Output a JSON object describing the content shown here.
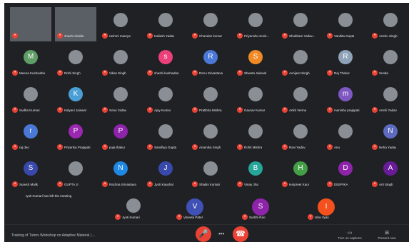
{
  "colors": {
    "background": "#202124",
    "mic_muted": "#ea4335",
    "text": "#e8eaed"
  },
  "tiles": [
    {
      "name": "",
      "kind": "video"
    },
    {
      "name": "shashi shukla",
      "kind": "video"
    },
    {
      "name": "rashmi maurya",
      "kind": "photo"
    },
    {
      "name": "Kailash Yadav",
      "kind": "photo"
    },
    {
      "name": "Chandan kumar",
      "kind": "photo"
    },
    {
      "name": "Priyanshu Sonk...",
      "kind": "photo"
    },
    {
      "name": "Shubham Yadav...",
      "kind": "photo"
    },
    {
      "name": "Vandita Gupta",
      "kind": "photo"
    },
    {
      "name": "Anshu Singh",
      "kind": "photo"
    },
    {
      "name": "Meena Kushwaha",
      "kind": "letter",
      "letter": "M",
      "color": "#5f9e66"
    },
    {
      "name": "Rishi Singh",
      "kind": "photo"
    },
    {
      "name": "Vikas Singh",
      "kind": "photo"
    },
    {
      "name": "shashi kushwaha",
      "kind": "letter",
      "letter": "s",
      "color": "#ec407a"
    },
    {
      "name": "Renu Srivastava",
      "kind": "letter",
      "letter": "R",
      "color": "#4a78d6"
    },
    {
      "name": "Shweta Jaiswal",
      "kind": "letter",
      "letter": "S",
      "color": "#f08a24"
    },
    {
      "name": "Avnijeet Singh",
      "kind": "photo"
    },
    {
      "name": "Raj Thakur",
      "kind": "letter",
      "letter": "R",
      "color": "#8fa3b8"
    },
    {
      "name": "Sunita",
      "kind": "photo"
    },
    {
      "name": "Sudha Kumari",
      "kind": "photo"
    },
    {
      "name": "Kalyani Jaiswal",
      "kind": "letter",
      "letter": "K",
      "color": "#4aa0d6"
    },
    {
      "name": "Sonu Yadav",
      "kind": "photo"
    },
    {
      "name": "Ajay Kumar",
      "kind": "photo"
    },
    {
      "name": "Pratibha Mishra",
      "kind": "photo"
    },
    {
      "name": "Gaurav Kumar",
      "kind": "photo"
    },
    {
      "name": "Ankit Verma",
      "kind": "photo"
    },
    {
      "name": "manisha prajapati",
      "kind": "letter",
      "letter": "m",
      "color": "#7e57c2"
    },
    {
      "name": "Anshi Yadav",
      "kind": "photo"
    },
    {
      "name": "raj deo",
      "kind": "letter",
      "letter": "r",
      "color": "#4a78d6"
    },
    {
      "name": "Priyanka Prajapati",
      "kind": "letter",
      "letter": "P",
      "color": "#9c27b0"
    },
    {
      "name": "puja thakur",
      "kind": "letter",
      "letter": "P",
      "color": "#8e24aa"
    },
    {
      "name": "Sandhya Gupta",
      "kind": "photo"
    },
    {
      "name": "Anamika Singh",
      "kind": "photo"
    },
    {
      "name": "Rohit Mishra",
      "kind": "photo"
    },
    {
      "name": "Ravi Yadav",
      "kind": "photo"
    },
    {
      "name": "Anu",
      "kind": "photo"
    },
    {
      "name": "Neha Yadav",
      "kind": "letter",
      "letter": "N",
      "color": "#5c6bc0"
    },
    {
      "name": "Suresh Malik",
      "kind": "letter",
      "letter": "S",
      "color": "#3949ab"
    },
    {
      "name": "GUPTA JI",
      "kind": "photo"
    },
    {
      "name": "Rachna Srivastava",
      "kind": "letter",
      "letter": "N",
      "color": "#1e88e5"
    },
    {
      "name": "Jyoti Kaushal",
      "kind": "letter",
      "letter": "J",
      "color": "#3949ab"
    },
    {
      "name": "Shalini Kumari",
      "kind": "photo"
    },
    {
      "name": "Vinay Jha",
      "kind": "letter",
      "letter": "B",
      "color": "#26a69a"
    },
    {
      "name": "Harpreet Kaur",
      "kind": "letter",
      "letter": "H",
      "color": "#43a047"
    },
    {
      "name": "DEEPIKA",
      "kind": "letter",
      "letter": "D",
      "color": "#8e24aa"
    },
    {
      "name": "Arti Singh",
      "kind": "letter",
      "letter": "A",
      "color": "#6a1b9a"
    }
  ],
  "large_tiles": [
    {
      "name": "Jyoti Kumari",
      "kind": "photo"
    },
    {
      "name": "Vineeta Patel",
      "kind": "letter",
      "letter": "V",
      "color": "#3f51b5"
    },
    {
      "name": "Surbhi Rao",
      "kind": "letter",
      "letter": "S",
      "color": "#8e24aa"
    },
    {
      "name": "Isha Vyas",
      "kind": "letter",
      "letter": "I",
      "color": "#f4511e"
    }
  ],
  "caption": "Iyoti Kumari has left the meeting",
  "bottom": {
    "meeting_title": "Training of Tutors Workshop on Adaptive Material | ...",
    "mic_icon": "mic-off-icon",
    "more_icon": "more-icon",
    "end_icon": "call-end-icon",
    "people_label": "Turn on captions",
    "present_label": "Present now"
  }
}
